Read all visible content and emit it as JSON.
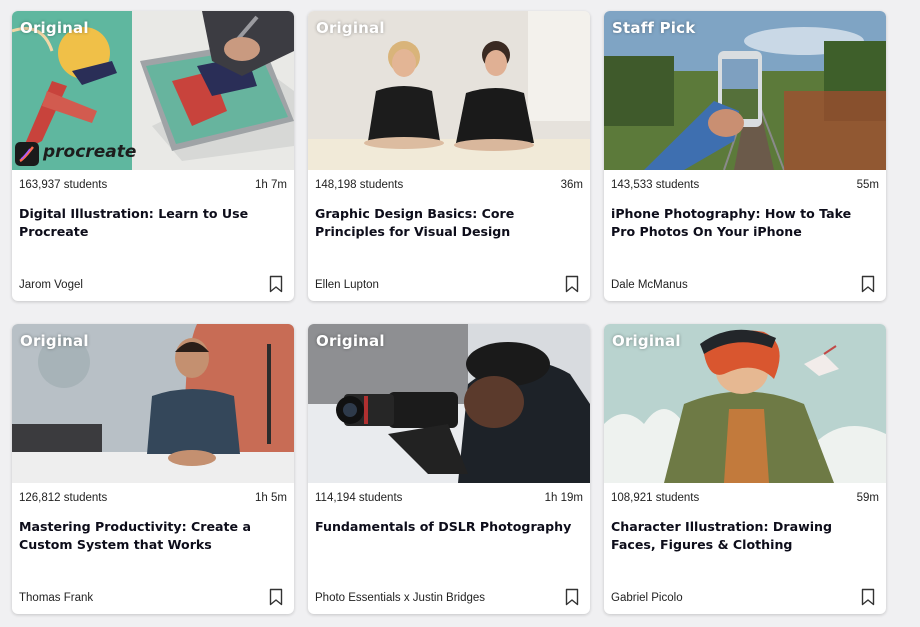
{
  "courses": [
    {
      "badge": "Original",
      "students": "163,937 students",
      "duration": "1h 7m",
      "title": "Digital Illustration: Learn to Use Procreate",
      "teacher": "Jarom Vogel",
      "logo_text": "procreate",
      "thumbnail_icon": "ipad-drawing-thumbnail"
    },
    {
      "badge": "Original",
      "students": "148,198 students",
      "duration": "36m",
      "title": "Graphic Design Basics: Core Principles for Visual Design",
      "teacher": "Ellen Lupton",
      "thumbnail_icon": "two-teachers-thumbnail"
    },
    {
      "badge": "Staff Pick",
      "students": "143,533 students",
      "duration": "55m",
      "title": "iPhone Photography: How to Take Pro Photos On Your iPhone",
      "teacher": "Dale McManus",
      "thumbnail_icon": "phone-photo-thumbnail"
    },
    {
      "badge": "Original",
      "students": "126,812 students",
      "duration": "1h 5m",
      "title": "Mastering Productivity: Create a Custom System that Works",
      "teacher": "Thomas Frank",
      "thumbnail_icon": "teacher-at-desk-thumbnail"
    },
    {
      "badge": "Original",
      "students": "114,194 students",
      "duration": "1h 19m",
      "title": "Fundamentals of DSLR Photography",
      "teacher": "Photo Essentials x Justin Bridges",
      "thumbnail_icon": "dslr-photographer-thumbnail"
    },
    {
      "badge": "Original",
      "students": "108,921 students",
      "duration": "59m",
      "title": "Character Illustration: Drawing Faces, Figures & Clothing",
      "teacher": "Gabriel Picolo",
      "thumbnail_icon": "character-illustration-thumbnail"
    }
  ],
  "icons": {
    "bookmark": "bookmark-icon"
  },
  "colors": {
    "background": "#f0f0f2",
    "card": "#ffffff",
    "title_text": "#0d0d1a",
    "badge_text": "#ffffff"
  }
}
